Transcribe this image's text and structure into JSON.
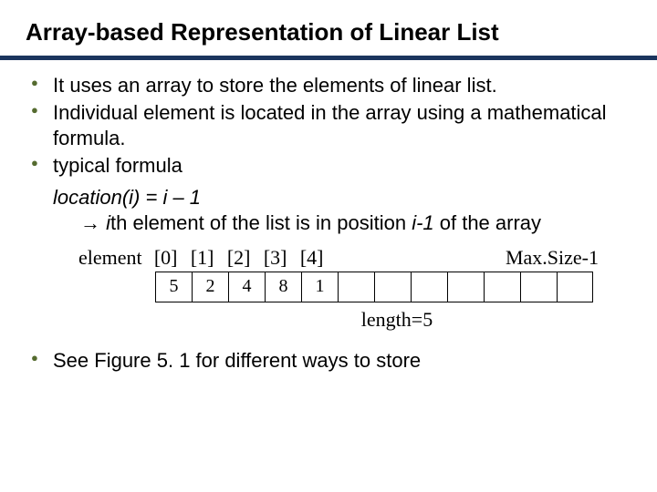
{
  "title": "Array-based Representation of Linear List",
  "bullets": [
    "It uses an array to store the elements of linear list.",
    "Individual element is located in the array using a mathematical formula.",
    "typical formula"
  ],
  "formula": {
    "line1": "location(i) = i – 1",
    "arrow": "→",
    "line2_pre": " ",
    "line2_ith": "i",
    "line2_mid": "th element of the list is in position ",
    "line2_im1": "i-1",
    "line2_post": " of the array"
  },
  "array_label_word": "element",
  "array_indices": [
    "[0]",
    "[1]",
    "[2]",
    "[3]",
    "[4]"
  ],
  "maxsize_label": "Max.Size-1",
  "array_values": [
    "5",
    "2",
    "4",
    "8",
    "1",
    "",
    "",
    "",
    "",
    "",
    "",
    ""
  ],
  "length_label": "length=5",
  "bullets2": [
    "See Figure 5. 1 for different ways to store"
  ]
}
